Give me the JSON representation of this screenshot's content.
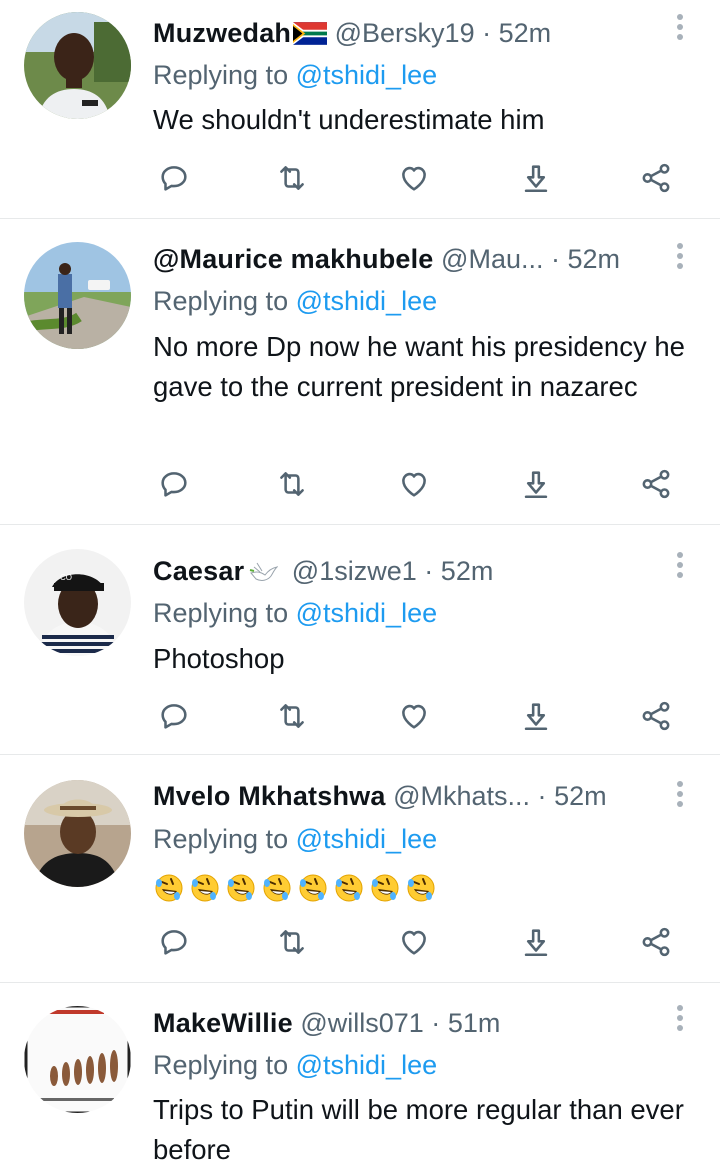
{
  "replying_prefix": "Replying to",
  "tweets": [
    {
      "name": "Muzwedah",
      "name_emoji": "south-africa-flag",
      "handle": "@Bersky19",
      "dot": "·",
      "time": "52m",
      "replying_to": "@tshidi_lee",
      "text": "We shouldn't underestimate him"
    },
    {
      "name": "@Maurice makhubele",
      "handle": "@Mau...",
      "dot": "·",
      "time": "52m",
      "replying_to": "@tshidi_lee",
      "text": "No more Dp now he want his presidency he gave to the current president in nazarec"
    },
    {
      "name": "Caesar",
      "name_emoji": "dove",
      "handle": "@1sizwe1",
      "dot": "·",
      "time": "52m",
      "replying_to": "@tshidi_lee",
      "text": "Photoshop"
    },
    {
      "name": "Mvelo Mkhatshwa",
      "handle": "@Mkhats...",
      "dot": "·",
      "time": "52m",
      "replying_to": "@tshidi_lee",
      "text": "🤣🤣🤣🤣🤣🤣🤣🤣",
      "emoji_count": 8
    },
    {
      "name": "MakeWillie",
      "handle": "@wills071",
      "dot": "·",
      "time": "51m",
      "replying_to": "@tshidi_lee",
      "text": "Trips to Putin will be more regular than ever before"
    }
  ],
  "action_icons": [
    "reply-icon",
    "retweet-icon",
    "like-icon",
    "share-download-icon",
    "share-icon"
  ],
  "colors": {
    "link": "#1d9bf0",
    "muted": "#536471",
    "text": "#0f1419",
    "divider": "#e7e9ea"
  }
}
